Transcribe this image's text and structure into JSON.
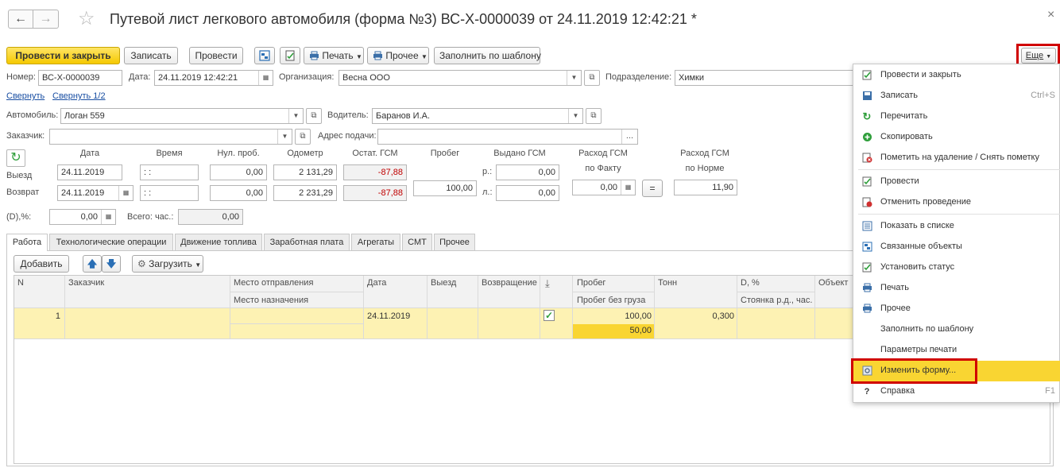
{
  "header": {
    "title": "Путевой лист легкового автомобиля (форма №3) ВС-Х-0000039 от 24.11.2019 12:42:21 *",
    "back_glyph": "←",
    "fwd_glyph": "→",
    "star_glyph": "☆",
    "close_glyph": "×"
  },
  "toolbar": {
    "post_close": "Провести и закрыть",
    "save": "Записать",
    "post": "Провести",
    "print": "Печать",
    "other": "Прочее",
    "fill_template": "Заполнить по шаблону",
    "more": "Еще"
  },
  "fields": {
    "number_label": "Номер:",
    "number": "ВС-Х-0000039",
    "date_label": "Дата:",
    "date": "24.11.2019 12:42:21",
    "org_label": "Организация:",
    "org": "Весна ООО",
    "dept_label": "Подразделение:",
    "dept": "Химки",
    "collapse": "Свернуть",
    "collapse_half": "Свернуть 1/2",
    "car_label": "Автомобиль:",
    "car": "Логан 559",
    "driver_label": "Водитель:",
    "driver": "Баранов И.А.",
    "customer_label": "Заказчик:",
    "customer": "",
    "address_label": "Адрес подачи:",
    "address": "",
    "ellipsis": "..."
  },
  "trip": {
    "col_date": "Дата",
    "col_time": "Время",
    "col_zero": "Нул. проб.",
    "col_odometer": "Одометр",
    "col_fuel_rest": "Остат. ГСМ",
    "col_mileage": "Пробег",
    "col_fuel_issued": "Выдано ГСМ",
    "col_fuel_fact_1": "Расход ГСМ",
    "col_fuel_fact_2": "по Факту",
    "col_fuel_norm_1": "Расход ГСМ",
    "col_fuel_norm_2": "по Норме",
    "depart_label": "Выезд",
    "return_label": "Возврат",
    "depart_date": "24.11.2019",
    "depart_time": " :  : ",
    "depart_zero": "0,00",
    "depart_odometer": "2 131,29",
    "depart_fuel": "-87,88",
    "return_date": "24.11.2019",
    "return_time": " :  : ",
    "return_zero": "0,00",
    "return_odometer": "2 231,29",
    "return_fuel": "-87,88",
    "mileage": "100,00",
    "r_label": "р.:",
    "l_label": "л.:",
    "issued_r": "0,00",
    "issued_l": "0,00",
    "fuel_fact": "0,00",
    "eq": "=",
    "fuel_norm": "11,90",
    "d_label": "(D),%:",
    "d_value": "0,00",
    "hours_label": "Всего: час.:",
    "hours_value": "0,00",
    "refresh_glyph": "↻"
  },
  "tabs": [
    {
      "label": "Работа"
    },
    {
      "label": "Технологические операции"
    },
    {
      "label": "Движение топлива"
    },
    {
      "label": "Заработная плата"
    },
    {
      "label": "Агрегаты"
    },
    {
      "label": "СМТ"
    },
    {
      "label": "Прочее"
    }
  ],
  "table_toolbar": {
    "add": "Добавить",
    "load": "Загрузить"
  },
  "table": {
    "headers": {
      "n": "N",
      "customer": "Заказчик",
      "from": "Место отправления",
      "to": "Место назначения",
      "date": "Дата",
      "depart": "Выезд",
      "return": "Возвращение",
      "mileage": "Пробег",
      "mileage_empty": "Пробег без груза",
      "tons": "Тонн",
      "d": "D, %",
      "parking": "Стоянка р.д., час.",
      "object": "Объект"
    },
    "row": {
      "n": "1",
      "date": "24.11.2019",
      "mileage": "100,00",
      "mileage_empty": "50,00",
      "tons": "0,300"
    }
  },
  "menu": {
    "items": [
      {
        "label": "Провести и закрыть",
        "icon": "post-close-icon",
        "key": ""
      },
      {
        "label": "Записать",
        "icon": "save-icon",
        "key": "Ctrl+S"
      },
      {
        "label": "Перечитать",
        "icon": "reload-icon",
        "key": ""
      },
      {
        "label": "Скопировать",
        "icon": "copy-icon",
        "key": ""
      },
      {
        "label": "Пометить на удаление / Снять пометку",
        "icon": "delete-mark-icon",
        "key": ""
      },
      {
        "label": "Провести",
        "icon": "post-icon",
        "key": ""
      },
      {
        "label": "Отменить проведение",
        "icon": "unpost-icon",
        "key": ""
      },
      {
        "label": "Показать в списке",
        "icon": "list-icon",
        "key": ""
      },
      {
        "label": "Связанные объекты",
        "icon": "linked-objects-icon",
        "key": ""
      },
      {
        "label": "Установить статус",
        "icon": "status-icon",
        "key": ""
      },
      {
        "label": "Печать",
        "icon": "print-icon",
        "key": ""
      },
      {
        "label": "Прочее",
        "icon": "other-print-icon",
        "key": ""
      },
      {
        "label": "Заполнить по шаблону",
        "icon": "",
        "key": ""
      },
      {
        "label": "Параметры печати",
        "icon": "",
        "key": ""
      },
      {
        "label": "Изменить форму...",
        "icon": "change-form-icon",
        "key": ""
      },
      {
        "label": "Справка",
        "icon": "help-icon",
        "key": "F1"
      }
    ]
  },
  "colors": {
    "accent_yellow": "#f5c900",
    "highlight_red": "#d00000",
    "row_yellow": "#fdf2b3",
    "cell_yellow": "#f9d532",
    "menu_highlight": "#f9d532",
    "link_blue": "#1a4fa3"
  }
}
